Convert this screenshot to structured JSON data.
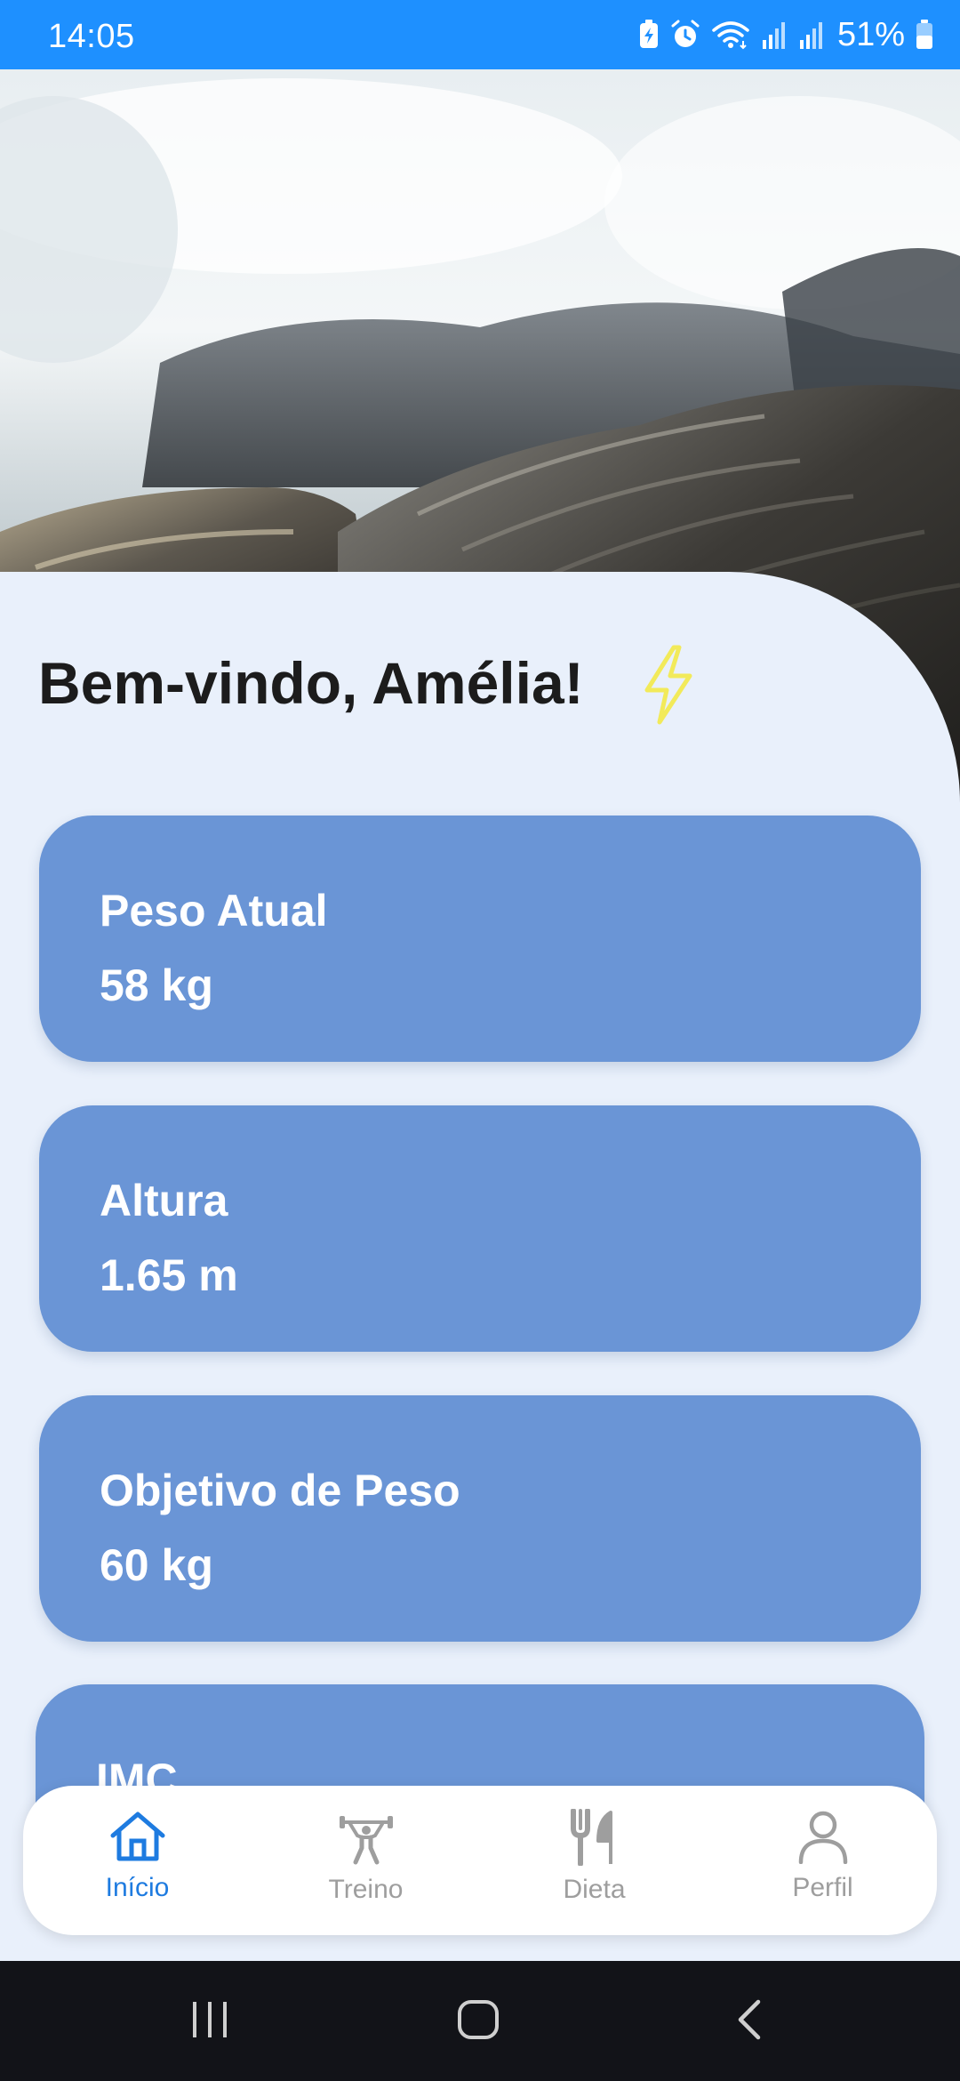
{
  "status_bar": {
    "time": "14:05",
    "battery": "51%",
    "icons": [
      "battery-saver-icon",
      "alarm-icon",
      "wifi-icon",
      "signal-icon",
      "signal-icon",
      "battery-icon"
    ]
  },
  "header": {
    "welcome": "Bem-vindo, Amélia!",
    "bolt_icon": "lightning-bolt-icon",
    "bolt_color": "#f2ea5a"
  },
  "cards": [
    {
      "label": "Peso Atual",
      "value": "58 kg"
    },
    {
      "label": "Altura",
      "value": "1.65 m"
    },
    {
      "label": "Objetivo de Peso",
      "value": "60 kg"
    },
    {
      "label": "IMC",
      "value": ""
    }
  ],
  "bottom_nav": {
    "items": [
      {
        "label": "Início",
        "icon": "home-icon",
        "active": true
      },
      {
        "label": "Treino",
        "icon": "weightlifter-icon",
        "active": false
      },
      {
        "label": "Dieta",
        "icon": "fork-knife-icon",
        "active": false
      },
      {
        "label": "Perfil",
        "icon": "person-icon",
        "active": false
      }
    ]
  },
  "colors": {
    "status_bar": "#1e90ff",
    "background": "#e9f0fb",
    "card": "#6a95d6",
    "nav_active": "#1e7be0",
    "nav_inactive": "#9e9e9e"
  }
}
